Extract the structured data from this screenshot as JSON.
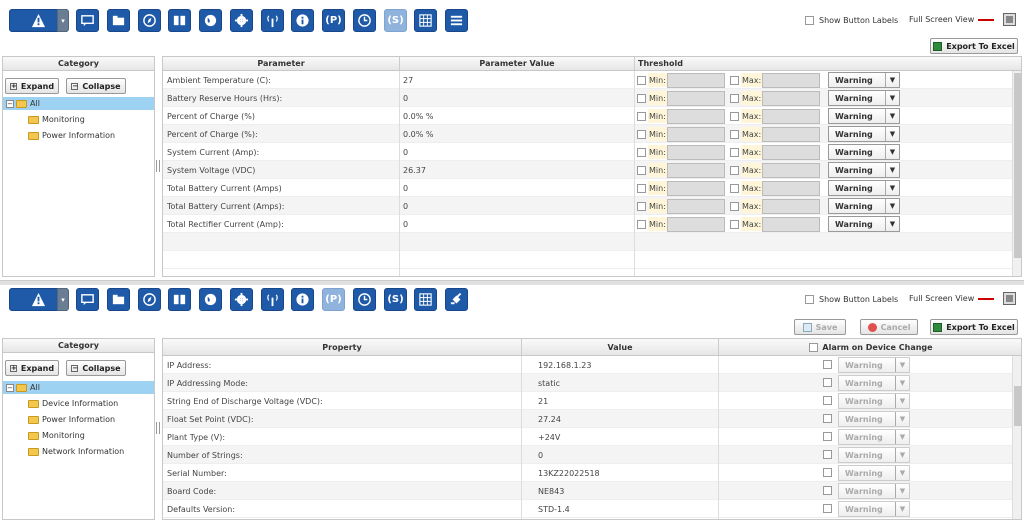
{
  "top": {
    "show_labels": "Show Button Labels",
    "full_screen": "Full Screen View",
    "export": "Export To Excel",
    "category_header": "Category",
    "expand": "Expand",
    "collapse": "Collapse",
    "tree": {
      "root": "All",
      "items": [
        "Monitoring",
        "Power Information"
      ]
    },
    "columns": {
      "param": "Parameter",
      "value": "Parameter Value",
      "threshold": "Threshold"
    },
    "min_label": "Min:",
    "max_label": "Max:",
    "rows": [
      {
        "param": "Ambient Temperature (C):",
        "value": "27",
        "severity": "Warning"
      },
      {
        "param": "Battery Reserve Hours (Hrs):",
        "value": "0",
        "severity": "Warning"
      },
      {
        "param": "Percent of Charge (%)",
        "value": "0.0% %",
        "severity": "Warning"
      },
      {
        "param": "Percent of Charge (%):",
        "value": "0.0% %",
        "severity": "Warning"
      },
      {
        "param": "System Current (Amp):",
        "value": "0",
        "severity": "Warning"
      },
      {
        "param": "System Voltage (VDC)",
        "value": "26.37",
        "severity": "Warning"
      },
      {
        "param": "Total Battery Current (Amps)",
        "value": "0",
        "severity": "Warning"
      },
      {
        "param": "Total Battery Current (Amps):",
        "value": "0",
        "severity": "Warning"
      },
      {
        "param": "Total Rectifier Current (Amp):",
        "value": "0",
        "severity": "Warning"
      }
    ]
  },
  "bottom": {
    "show_labels": "Show Button Labels",
    "full_screen": "Full Screen View",
    "save": "Save",
    "cancel": "Cancel",
    "export": "Export To Excel",
    "category_header": "Category",
    "expand": "Expand",
    "collapse": "Collapse",
    "tree": {
      "root": "All",
      "items": [
        "Device Information",
        "Power Information",
        "Monitoring",
        "Network Information"
      ]
    },
    "columns": {
      "property": "Property",
      "value": "Value",
      "alarm": "Alarm on Device Change"
    },
    "rows": [
      {
        "property": "IP Address:",
        "value": "192.168.1.23",
        "severity": "Warning"
      },
      {
        "property": "IP Addressing Mode:",
        "value": "static",
        "severity": "Warning"
      },
      {
        "property": "String End of Discharge Voltage (VDC):",
        "value": "21",
        "severity": "Warning"
      },
      {
        "property": "Float Set Point (VDC):",
        "value": "27.24",
        "severity": "Warning"
      },
      {
        "property": "Plant Type (V):",
        "value": "+24V",
        "severity": "Warning"
      },
      {
        "property": "Number of Strings:",
        "value": "0",
        "severity": "Warning"
      },
      {
        "property": "Serial Number:",
        "value": "13KZ22022518",
        "severity": "Warning"
      },
      {
        "property": "Board Code:",
        "value": "NE843",
        "severity": "Warning"
      },
      {
        "property": "Defaults Version:",
        "value": "STD-1.4",
        "severity": "Warning"
      }
    ]
  },
  "toolbar_icons": [
    "alarm-icon",
    "message-icon",
    "folder-icon",
    "compass-icon",
    "book-icon",
    "globe-icon",
    "gear-icon",
    "antenna-icon",
    "info-icon",
    "P",
    "history-icon",
    "S",
    "grid-icon",
    "menu-icon"
  ],
  "toolbar_icons_bottom": [
    "alarm-icon",
    "message-icon",
    "folder-icon",
    "compass-icon",
    "book-icon",
    "globe-icon",
    "gear-icon",
    "antenna-icon",
    "info-icon",
    "P",
    "history-icon",
    "S",
    "grid-icon",
    "plug-icon"
  ],
  "colors": {
    "toolbar_blue": "#1e5aa8",
    "selected": "#9dd2f3",
    "folder": "#f3c74f"
  }
}
